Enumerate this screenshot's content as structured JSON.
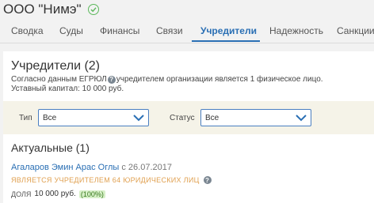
{
  "company": {
    "name": "ООО \"Нимэ\""
  },
  "tabs": [
    {
      "label": "Сводка"
    },
    {
      "label": "Суды"
    },
    {
      "label": "Финансы"
    },
    {
      "label": "Связи"
    },
    {
      "label": "Учредители"
    },
    {
      "label": "Надежность"
    },
    {
      "label": "Санкции"
    }
  ],
  "active_tab": "Учредители",
  "colors": {
    "accent": "#2a6fb4",
    "verified": "#5cb85c",
    "founder_badge": "#e0a050",
    "share_pct_bg": "#d7f0c8"
  },
  "founders": {
    "title": "Учредители (2)",
    "info_part1": "Согласно данным ЕГРЮЛ",
    "info_part2": "учредителем организации является 1 физическое лицо.",
    "capital": "Уставный капитал: 10 000 руб."
  },
  "filters": {
    "type_label": "Тип",
    "type_value": "Все",
    "status_label": "Статус",
    "status_value": "Все"
  },
  "actual": {
    "title": "Актуальные (1)",
    "person": {
      "name": "Агаларов Эмин Арас Оглы",
      "since": "с 26.07.2017",
      "badge": "ЯВЛЯЕТСЯ УЧРЕДИТЕЛЕМ 64 ЮРИДИЧЕСКИХ ЛИЦ",
      "share_label": "ДОЛЯ",
      "share_value": "10 000 руб.",
      "share_pct": "(100%)"
    }
  }
}
